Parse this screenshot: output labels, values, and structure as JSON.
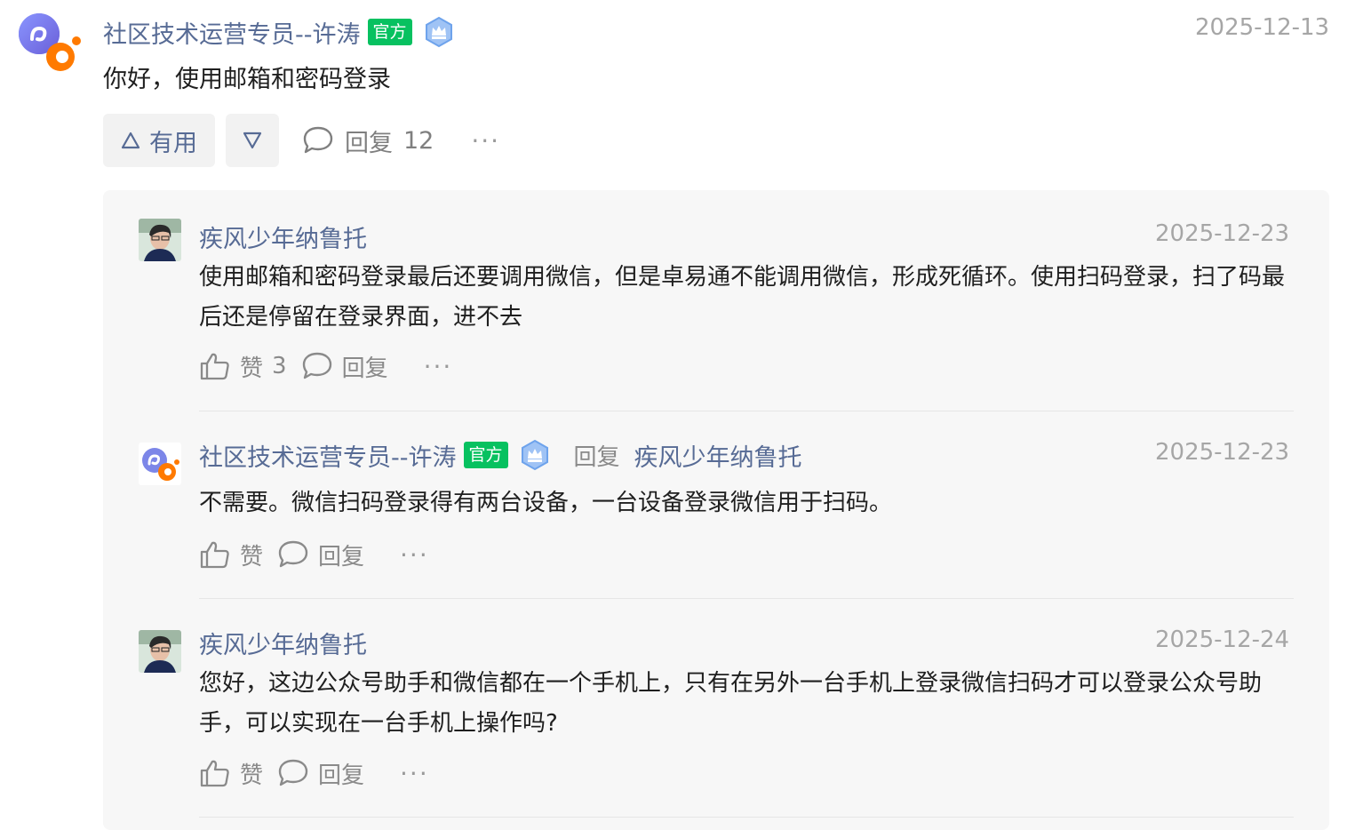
{
  "post": {
    "author": "社区技术运营专员--许涛",
    "badge": "官方",
    "date": "2025-12-13",
    "text": "你好，使用邮箱和密码登录",
    "useful_label": "有用",
    "reply_label": "回复",
    "reply_count": "12",
    "more": "···"
  },
  "replies": [
    {
      "author": "疾风少年纳鲁托",
      "date": "2025-12-23",
      "text": "使用邮箱和密码登录最后还要调用微信，但是卓易通不能调用微信，形成死循环。使用扫码登录，扫了码最后还是停留在登录界面，进不去",
      "like_label": "赞",
      "like_count": "3",
      "reply_label": "回复",
      "more": "···"
    },
    {
      "author": "社区技术运营专员--许涛",
      "badge": "官方",
      "reply_to_label": "回复",
      "reply_to": "疾风少年纳鲁托",
      "date": "2025-12-23",
      "text": "不需要。微信扫码登录得有两台设备，一台设备登录微信用于扫码。",
      "like_label": "赞",
      "reply_label": "回复",
      "more": "···"
    },
    {
      "author": "疾风少年纳鲁托",
      "date": "2025-12-24",
      "text": "您好，这边公众号助手和微信都在一个手机上，只有在另外一台手机上登录微信扫码才可以登录公众号助手，可以实现在一台手机上操作吗?",
      "like_label": "赞",
      "reply_label": "回复",
      "more": "···"
    }
  ],
  "colors": {
    "link_blue": "#576b95",
    "official_green": "#07c160",
    "date_gray": "#a6a6a6",
    "reply_bg": "#f7f7f7"
  }
}
